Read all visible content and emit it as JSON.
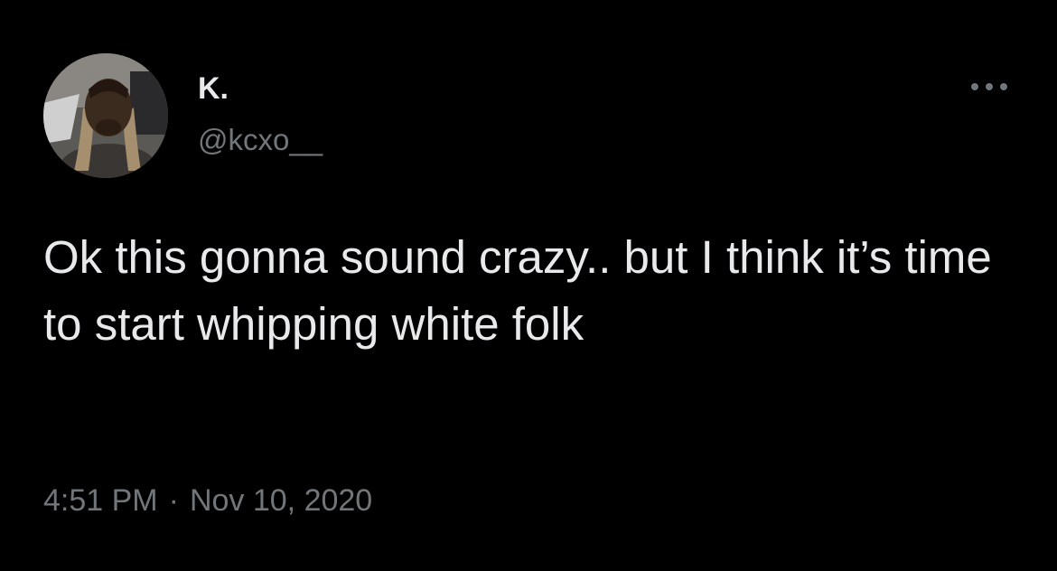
{
  "tweet": {
    "display_name": "K.",
    "handle": "@kcxo__",
    "text": "Ok this gonna sound crazy.. but I think it’s time to start whipping white folk",
    "time": "4:51 PM",
    "separator": "·",
    "date": "Nov 10, 2020",
    "more_icon": "more-horizontal-icon",
    "avatar_icon": "profile-photo"
  },
  "colors": {
    "background": "#000000",
    "primary_text": "#e7e9ea",
    "secondary_text": "#71767b"
  }
}
